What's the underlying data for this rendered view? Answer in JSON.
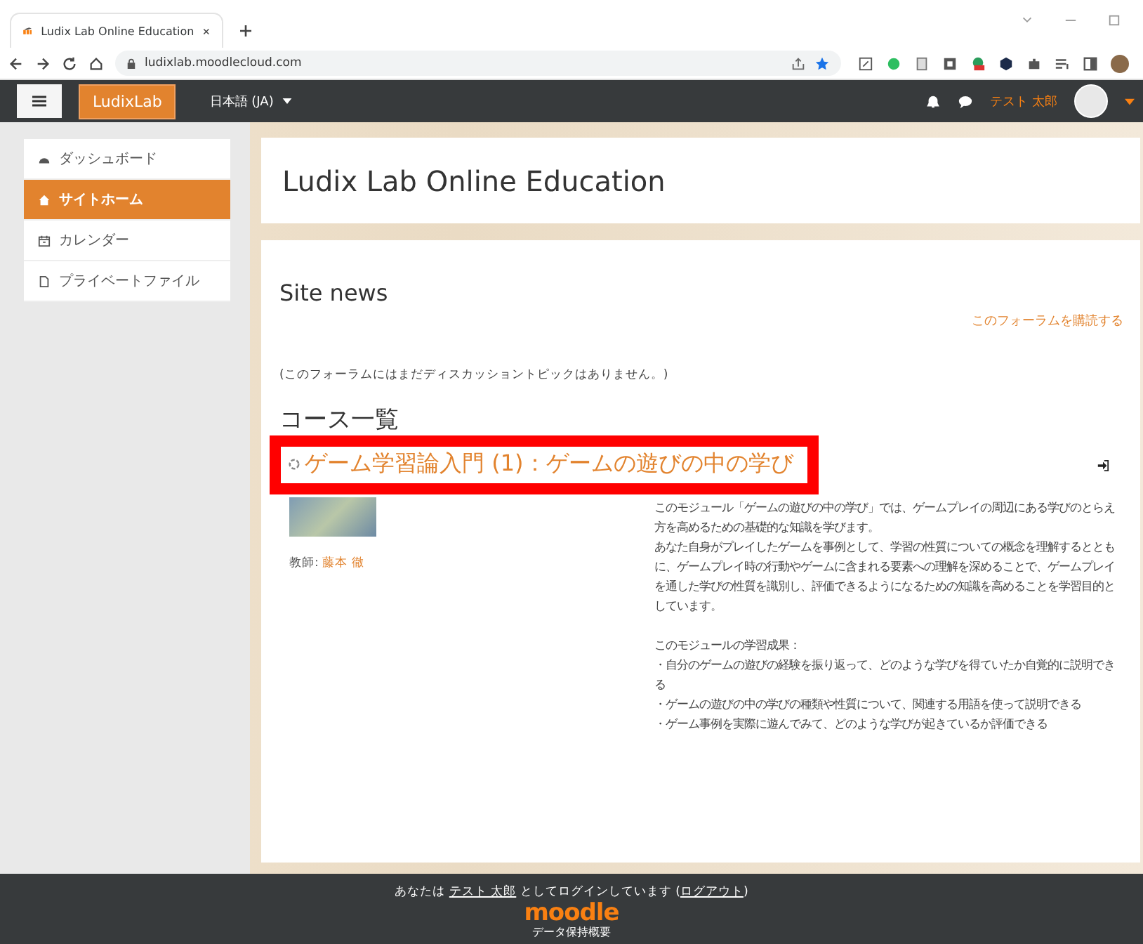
{
  "browser": {
    "tab_title": "Ludix Lab Online Education",
    "url": "ludixlab.moodlecloud.com"
  },
  "navbar": {
    "brand": "LudixLab",
    "language": "日本語 (JA)",
    "user_name": "テスト 太郎"
  },
  "sidebar": {
    "items": [
      {
        "label": "ダッシュボード",
        "selected": false
      },
      {
        "label": "サイトホーム",
        "selected": true
      },
      {
        "label": "カレンダー",
        "selected": false
      },
      {
        "label": "プライベートファイル",
        "selected": false
      }
    ]
  },
  "header": {
    "title": "Ludix Lab Online Education"
  },
  "site_news": {
    "title": "Site news",
    "subscribe_link": "このフォーラムを購読する",
    "empty_message": "(このフォーラムにはまだディスカッショントピックはありません。)"
  },
  "courses": {
    "heading": "コース一覧",
    "items": [
      {
        "title": "ゲーム学習論入門 (1)：ゲームの遊びの中の学び",
        "highlighted": true,
        "teacher_label": "教師:",
        "teacher_name": "藤本 徹",
        "summary": [
          "このモジュール「ゲームの遊びの中の学び」では、ゲームプレイの周辺にある学びのとらえ方を高めるための基礎的な知識を学びます。",
          "あなた自身がプレイしたゲームを事例として、学習の性質についての概念を理解するとともに、ゲームプレイ時の行動やゲームに含まれる要素への理解を深めることで、ゲームプレイを通した学びの性質を識別し、評価できるようになるための知識を高めることを学習目的としています。"
        ],
        "outcomes": [
          "このモジュールの学習成果：",
          "・自分のゲームの遊びの経験を振り返って、どのような学びを得ていたか自覚的に説明できる",
          "・ゲームの遊びの中の学びの種類や性質について、関連する用語を使って説明できる",
          "・ゲーム事例を実際に遊んでみて、どのような学びが起きているか評価できる"
        ]
      }
    ]
  },
  "footer": {
    "login_prefix": "あなたは",
    "user_name": "テスト 太郎",
    "login_middle": "としてログインしています (",
    "login_suffix": ")",
    "logout_link": "ログアウト",
    "logo": "moodle",
    "data_retention": "データ保持概要"
  }
}
